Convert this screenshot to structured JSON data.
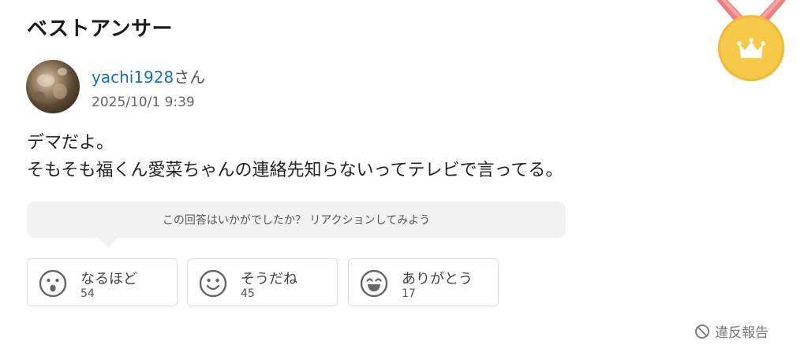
{
  "section": {
    "title": "ベストアンサー"
  },
  "answerer": {
    "username": "yachi1928",
    "honorific": "さん",
    "date": "2025/10/1 9:39"
  },
  "answer": {
    "lines": [
      "デマだよ。",
      "そもそも福くん愛菜ちゃんの連絡先知らないってテレビで言ってる。"
    ]
  },
  "reaction_prompt": "この回答はいかがでしたか？ リアクションしてみよう",
  "reactions": [
    {
      "label": "なるほど",
      "count": "54",
      "icon": "surprised-face-icon"
    },
    {
      "label": "そうだね",
      "count": "45",
      "icon": "smile-face-icon"
    },
    {
      "label": "ありがとう",
      "count": "17",
      "icon": "grin-face-icon"
    }
  ],
  "report": {
    "label": "違反報告",
    "icon": "prohibited-icon"
  },
  "colors": {
    "link": "#1b6fb3",
    "medal_gold": "#f7c948",
    "ribbon": "#ee7f7f"
  }
}
